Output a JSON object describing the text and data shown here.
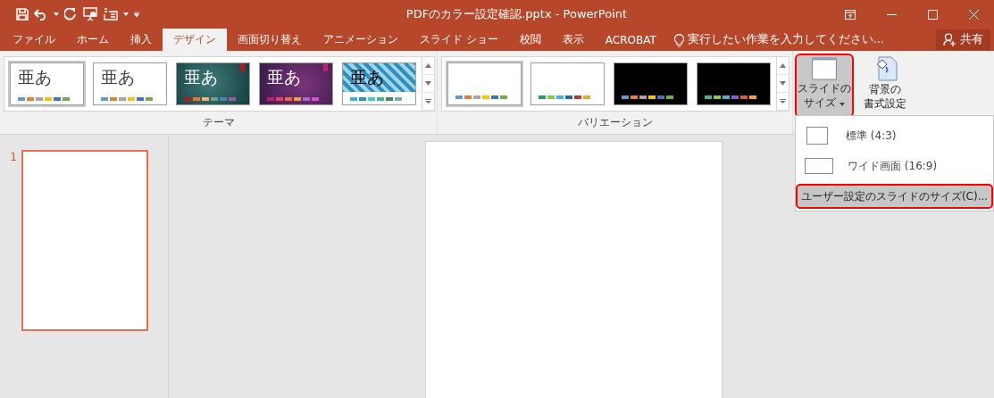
{
  "window": {
    "title": "PDFのカラー設定確認.pptx - PowerPoint"
  },
  "tabs": [
    {
      "label": "ファイル",
      "selected": false
    },
    {
      "label": "ホーム",
      "selected": false
    },
    {
      "label": "挿入",
      "selected": false
    },
    {
      "label": "デザイン",
      "selected": true
    },
    {
      "label": "画面切り替え",
      "selected": false
    },
    {
      "label": "アニメーション",
      "selected": false
    },
    {
      "label": "スライド ショー",
      "selected": false
    },
    {
      "label": "校閲",
      "selected": false
    },
    {
      "label": "表示",
      "selected": false
    },
    {
      "label": "ACROBAT",
      "selected": false
    }
  ],
  "tell_me": {
    "placeholder": "実行したい作業を入力してください..."
  },
  "share_button": {
    "label": "共有"
  },
  "themes": {
    "label": "テーマ",
    "items": [
      {
        "kind": "plain",
        "sample": "亜あ",
        "selected": true
      },
      {
        "kind": "plain",
        "sample": "亜あ",
        "selected": false
      },
      {
        "kind": "teal",
        "sample": "亜あ",
        "selected": false
      },
      {
        "kind": "purple",
        "sample": "亜あ",
        "selected": false
      },
      {
        "kind": "pattern",
        "sample": "亜あ",
        "selected": false
      }
    ]
  },
  "variations": {
    "label": "バリエーション",
    "items": [
      {
        "kind": "office-light",
        "selected": true
      },
      {
        "kind": "green-light",
        "selected": false
      },
      {
        "kind": "office-dark",
        "selected": false
      },
      {
        "kind": "green-dark",
        "selected": false
      }
    ]
  },
  "slide_size_button": {
    "label_1": "スライドの",
    "label_2": "サイズ",
    "highlighted": true,
    "selected": true
  },
  "background_button": {
    "label_1": "背景の",
    "label_2": "書式設定"
  },
  "slide_size_menu": [
    {
      "kind": "standard",
      "label": "標準 (4:3)",
      "selected": false,
      "highlighted": false
    },
    {
      "kind": "wide",
      "label": "ワイド画面 (16:9)",
      "selected": false,
      "highlighted": false
    },
    {
      "kind": "custom",
      "label": "ユーザー設定のスライドのサイズ(C)...",
      "selected": true,
      "highlighted": true
    }
  ],
  "thumbnails": [
    {
      "number": "1",
      "selected": true
    }
  ]
}
